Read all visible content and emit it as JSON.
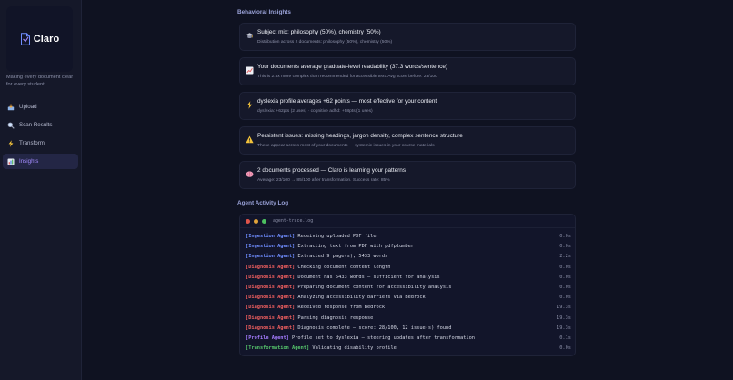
{
  "app": {
    "name": "Claro",
    "tagline": "Making every document clear for every student"
  },
  "colors": {
    "accent": "#a48cff",
    "ingestion": "#6f8dff",
    "diagnosis": "#ef5f5f",
    "profile": "#a57cff",
    "transformation": "#55c46b"
  },
  "sidebar": {
    "items": [
      {
        "label": "Upload",
        "icon": "inbox-tray-icon",
        "active": false
      },
      {
        "label": "Scan Results",
        "icon": "magnifier-icon",
        "active": false
      },
      {
        "label": "Transform",
        "icon": "lightning-icon",
        "active": false
      },
      {
        "label": "Insights",
        "icon": "bar-chart-icon",
        "active": true
      }
    ]
  },
  "insights": {
    "title": "Behavioral Insights",
    "cards": [
      {
        "icon": "graduation-cap-icon",
        "title": "Subject mix: philosophy (50%), chemistry (50%)",
        "subtitle": "Distribution across 2 documents: philosophy (50%), chemistry (50%)"
      },
      {
        "icon": "chart-up-icon",
        "title": "Your documents average graduate-level readability (37.3 words/sentence)",
        "subtitle": "This is 2.5x more complex than recommended for accessible text. Avg score before: 23/100"
      },
      {
        "icon": "lightning-icon",
        "title": "dyslexia profile averages +62 points — most effective for your content",
        "subtitle": "dyslexia: +62pts (2 uses) · cognitive adhd: +58pts (1 uses)"
      },
      {
        "icon": "warning-icon",
        "title": "Persistent issues: missing headings, jargon density, complex sentence structure",
        "subtitle": "These appear across most of your documents — systemic issues in your course materials"
      },
      {
        "icon": "brain-icon",
        "title": "2 documents processed — Claro is learning your patterns",
        "subtitle": "Average: 23/100 → 85/100 after transformation. Success rate: 85%"
      }
    ]
  },
  "activity": {
    "title": "Agent Activity Log",
    "file": "agent-trace.log",
    "lines": [
      {
        "agent": "[Ingestion Agent]",
        "type": "ingestion",
        "message": "Receiving uploaded PDF file",
        "time": "0.0s"
      },
      {
        "agent": "[Ingestion Agent]",
        "type": "ingestion",
        "message": "Extracting text from PDF with pdfplumber",
        "time": "0.0s"
      },
      {
        "agent": "[Ingestion Agent]",
        "type": "ingestion",
        "message": "Extracted 9 page(s), 5433 words",
        "time": "2.2s"
      },
      {
        "agent": "[Diagnosis Agent]",
        "type": "diagnosis",
        "message": "Checking document content length",
        "time": "0.0s"
      },
      {
        "agent": "[Diagnosis Agent]",
        "type": "diagnosis",
        "message": "Document has 5433 words — sufficient for analysis",
        "time": "0.0s"
      },
      {
        "agent": "[Diagnosis Agent]",
        "type": "diagnosis",
        "message": "Preparing document content for accessibility analysis",
        "time": "0.0s"
      },
      {
        "agent": "[Diagnosis Agent]",
        "type": "diagnosis",
        "message": "Analyzing accessibility barriers via Bedrock",
        "time": "0.0s"
      },
      {
        "agent": "[Diagnosis Agent]",
        "type": "diagnosis",
        "message": "Received response from Bedrock",
        "time": "19.3s"
      },
      {
        "agent": "[Diagnosis Agent]",
        "type": "diagnosis",
        "message": "Parsing diagnosis response",
        "time": "19.3s"
      },
      {
        "agent": "[Diagnosis Agent]",
        "type": "diagnosis",
        "message": "Diagnosis complete — score: 28/100, 12 issue(s) found",
        "time": "19.3s"
      },
      {
        "agent": "[Profile Agent]",
        "type": "profile",
        "message": "Profile set to dyslexia — steering updates after transformation",
        "time": "0.1s"
      },
      {
        "agent": "[Transformation Agent]",
        "type": "transformation",
        "message": "Validating disability profile",
        "time": "0.0s"
      }
    ]
  }
}
